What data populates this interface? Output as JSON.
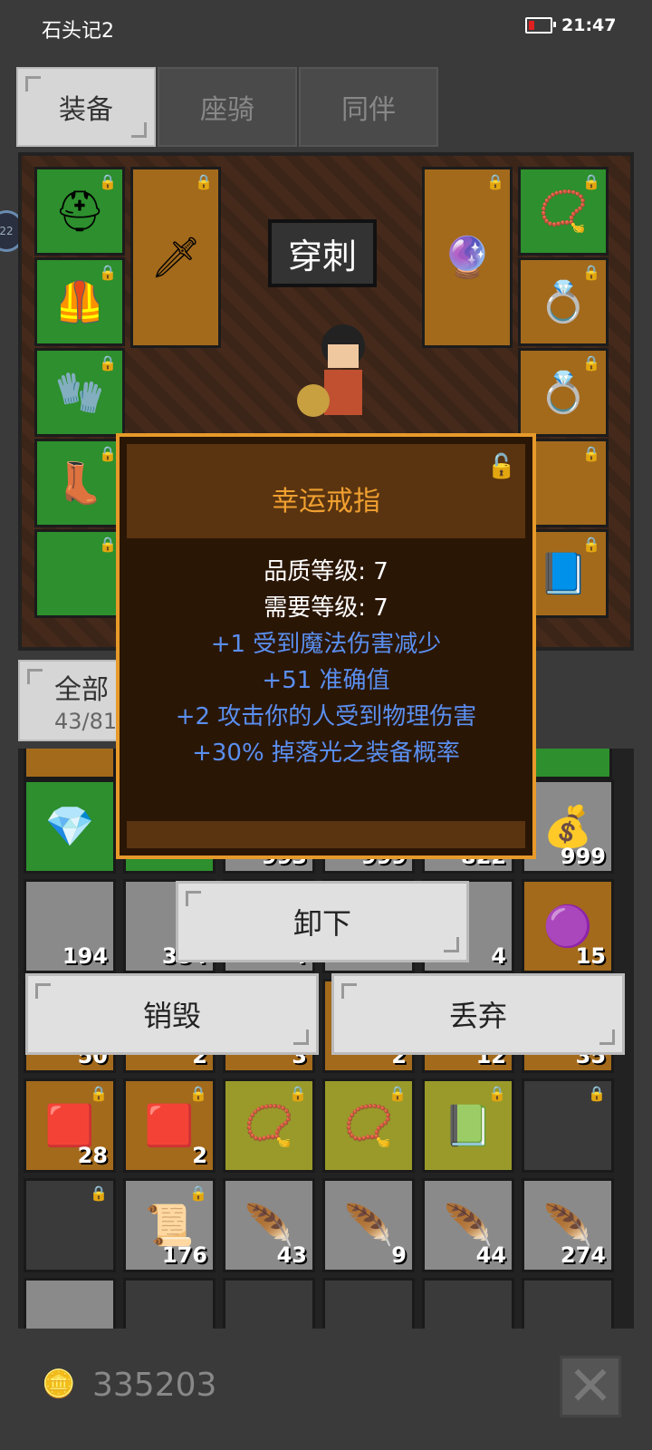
{
  "status": {
    "app_name": "石头记2",
    "time": "21:47"
  },
  "tabs": [
    {
      "label": "装备",
      "active": true
    },
    {
      "label": "座骑",
      "active": false
    },
    {
      "label": "同伴",
      "active": false
    }
  ],
  "equip": {
    "skill_label": "穿刺"
  },
  "filter": {
    "label": "全部",
    "count": "43/81"
  },
  "tooltip": {
    "name": "幸运戒指",
    "quality": "品质等级: 7",
    "required": "需要等级: 7",
    "stats": [
      "+1 受到魔法伤害减少",
      "+51 准确值",
      "+2 攻击你的人受到物理伤害",
      "+30% 掉落光之装备概率"
    ]
  },
  "actions": {
    "unequip": "卸下",
    "destroy": "销毁",
    "discard": "丢弃"
  },
  "inventory_counts": {
    "r1": [
      "993",
      "999",
      "822",
      "999"
    ],
    "r2": [
      "194",
      "354",
      "4",
      "4",
      "15"
    ],
    "r3": [
      "50",
      "2",
      "3",
      "2",
      "12",
      "35"
    ],
    "r4": [
      "28",
      "2"
    ],
    "r5": [
      "176",
      "43",
      "9",
      "44",
      "274"
    ]
  },
  "gold": "335203",
  "colors": {
    "tooltip_title": "#f0a030",
    "stat_blue": "#5a8ff0",
    "tooltip_border": "#e79a2a"
  }
}
